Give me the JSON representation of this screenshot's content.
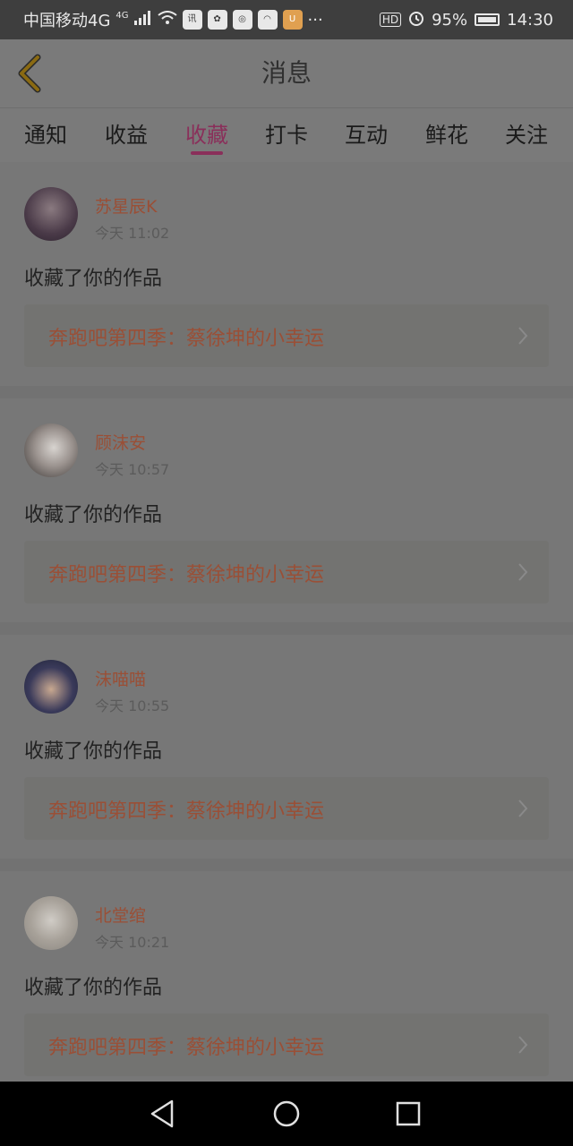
{
  "status_bar": {
    "carrier": "中国移动4G",
    "network_badge": "4G",
    "app_icons": [
      "news-app-icon",
      "baidu-app-icon",
      "browser-app-icon",
      "cloud-app-icon",
      "uc-app-icon"
    ],
    "more": "···",
    "hd": "HD",
    "battery_percent": "95%",
    "time": "14:30"
  },
  "header": {
    "title": "消息"
  },
  "tabs": [
    {
      "label": "通知"
    },
    {
      "label": "收益"
    },
    {
      "label": "收藏"
    },
    {
      "label": "打卡"
    },
    {
      "label": "互动"
    },
    {
      "label": "鲜花"
    },
    {
      "label": "关注"
    }
  ],
  "active_tab": "收藏",
  "messages": [
    {
      "username": "苏星辰K",
      "time": "今天 11:02",
      "action": "收藏了你的作品",
      "work_title": "奔跑吧第四季：蔡徐坤的小幸运"
    },
    {
      "username": "顾沫安",
      "time": "今天 10:57",
      "action": "收藏了你的作品",
      "work_title": "奔跑吧第四季：蔡徐坤的小幸运"
    },
    {
      "username": "沫喵喵",
      "time": "今天 10:55",
      "action": "收藏了你的作品",
      "work_title": "奔跑吧第四季：蔡徐坤的小幸运"
    },
    {
      "username": "北堂绾",
      "time": "今天 10:21",
      "action": "收藏了你的作品",
      "work_title": "奔跑吧第四季：蔡徐坤的小幸运"
    }
  ],
  "colors": {
    "accent": "#8a2f5a",
    "username": "#9a4f36",
    "back_arrow": "#8a6a12"
  }
}
